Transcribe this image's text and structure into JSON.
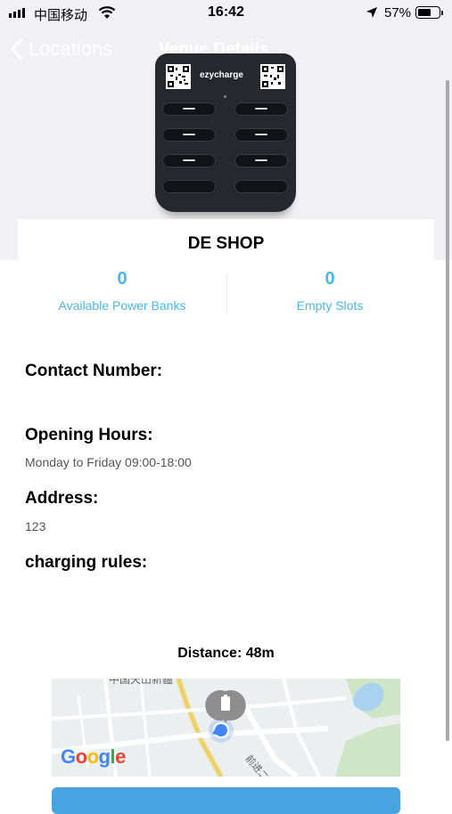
{
  "status": {
    "carrier": "中国移动",
    "time": "16:42",
    "battery_pct": "57%"
  },
  "nav": {
    "back_label": "Locations",
    "title": "Venue Details"
  },
  "device": {
    "brand": "ezycharge"
  },
  "venue": {
    "name": "DE SHOP",
    "available_power_banks": "0",
    "available_power_banks_label": "Available Power Banks",
    "empty_slots": "0",
    "empty_slots_label": "Empty Slots",
    "contact_label": "Contact Number:",
    "contact_value": "",
    "hours_label": "Opening Hours:",
    "hours_value": "Monday to Friday 09:00-18:00",
    "address_label": "Address:",
    "address_value": "123",
    "rules_label": "charging rules:",
    "rules_value": "",
    "distance": "Distance: 48m"
  },
  "map": {
    "road_label_1": "中国天山新疆",
    "road_label_2": "前进二路",
    "logo": "Google"
  },
  "colors": {
    "accent": "#49b8e8",
    "button": "#49a3e0"
  }
}
